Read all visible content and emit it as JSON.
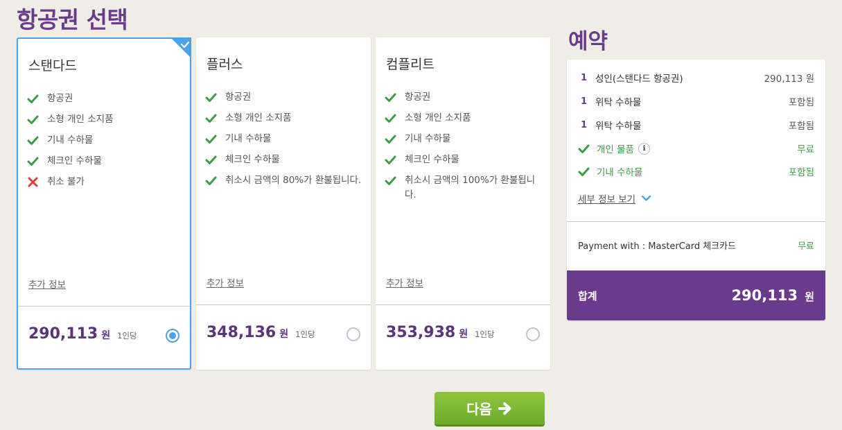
{
  "page_title": "항공권 선택",
  "summary_title": "예약",
  "colors": {
    "accent_purple": "#6a3a8c",
    "selected_blue": "#4aa3e6",
    "check_green": "#3e9a48",
    "cross_red": "#d9403a",
    "button_green": "#7ab834"
  },
  "cards": [
    {
      "name": "스탠다드",
      "selected": true,
      "features": [
        {
          "text": "항공권",
          "included": true
        },
        {
          "text": "소형 개인 소지품",
          "included": true
        },
        {
          "text": "기내 수하물",
          "included": true
        },
        {
          "text": "체크인 수하물",
          "included": true
        },
        {
          "text": "취소 불가",
          "included": false
        }
      ],
      "more_info": "추가 정보",
      "price": "290,113",
      "currency": "원",
      "per_person": "1인당"
    },
    {
      "name": "플러스",
      "selected": false,
      "features": [
        {
          "text": "항공권",
          "included": true
        },
        {
          "text": "소형 개인 소지품",
          "included": true
        },
        {
          "text": "기내 수하물",
          "included": true
        },
        {
          "text": "체크인 수하물",
          "included": true
        },
        {
          "text": "취소시 금액의 80%가 환불됩니다.",
          "included": true
        }
      ],
      "more_info": "추가 정보",
      "price": "348,136",
      "currency": "원",
      "per_person": "1인당"
    },
    {
      "name": "컴플리트",
      "selected": false,
      "features": [
        {
          "text": "항공권",
          "included": true
        },
        {
          "text": "소형 개인 소지품",
          "included": true
        },
        {
          "text": "기내 수하물",
          "included": true
        },
        {
          "text": "체크인 수하물",
          "included": true
        },
        {
          "text": "취소시 금액의 100%가 환불됩니다.",
          "included": true
        }
      ],
      "more_info": "추가 정보",
      "price": "353,938",
      "currency": "원",
      "per_person": "1인당"
    }
  ],
  "summary": {
    "items": [
      {
        "qty": "1",
        "label": "성인(스탠다드 항공권)",
        "value": "290,113 원"
      },
      {
        "qty": "1",
        "label": "위탁 수하물",
        "value": "포함됨"
      },
      {
        "qty": "1",
        "label": "위탁 수하물",
        "value": "포함됨"
      },
      {
        "label": "개인 물품",
        "value": "무료",
        "info_icon": "i"
      },
      {
        "label": "기내 수하물",
        "value": "포함됨"
      }
    ],
    "details_link": "세부 정보 보기",
    "payment_label": "Payment with : MasterCard 체크카드",
    "payment_value": "무료",
    "total_label": "합계",
    "total_amount": "290,113",
    "total_unit": "원"
  },
  "next_button": "다음"
}
